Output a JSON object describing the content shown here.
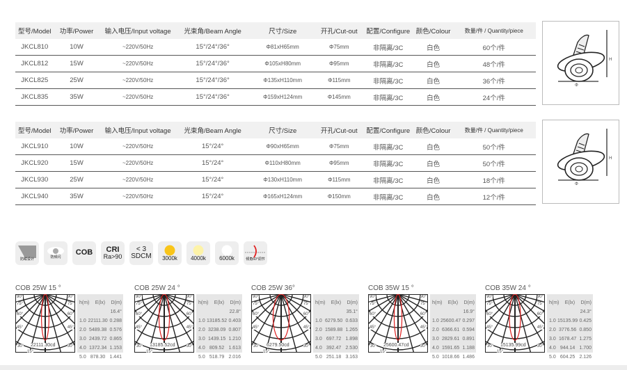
{
  "table_headers": [
    "型号/Model",
    "功率/Power",
    "输入电压/Input voltage",
    "光束角/Beam Angle",
    "尺寸/Size",
    "开孔/Cut-out",
    "配置/Configure",
    "颜色/Colour",
    "数量/件 / Quantity/piece"
  ],
  "table1": [
    [
      "JKCL810",
      "10W",
      "~220V/50Hz",
      "15°/24°/36°",
      "Φ81xH65mm",
      "Φ75mm",
      "非隔离/3C",
      "白色",
      "60个/件"
    ],
    [
      "JKCL812",
      "15W",
      "~220V/50Hz",
      "15°/24°/36°",
      "Φ105xH80mm",
      "Φ95mm",
      "非隔离/3C",
      "白色",
      "48个/件"
    ],
    [
      "JKCL825",
      "25W",
      "~220V/50Hz",
      "15°/24°/36°",
      "Φ135xH110mm",
      "Φ115mm",
      "非隔离/3C",
      "白色",
      "36个/件"
    ],
    [
      "JKCL835",
      "35W",
      "~220V/50Hz",
      "15°/24°/36°",
      "Φ159xH124mm",
      "Φ145mm",
      "非隔离/3C",
      "白色",
      "24个/件"
    ]
  ],
  "table2": [
    [
      "JKCL910",
      "10W",
      "~220V/50Hz",
      "15°/24°",
      "Φ90xH65mm",
      "Φ75mm",
      "非隔离/3C",
      "白色",
      "50个/件"
    ],
    [
      "JKCL920",
      "15W",
      "~220V/50Hz",
      "15°/24°",
      "Φ110xH80mm",
      "Φ95mm",
      "非隔离/3C",
      "白色",
      "50个/件"
    ],
    [
      "JKCL930",
      "25W",
      "~220V/50Hz",
      "15°/24°",
      "Φ130xH110mm",
      "Φ115mm",
      "非隔离/3C",
      "白色",
      "18个/件"
    ],
    [
      "JKCL940",
      "35W",
      "~220V/50Hz",
      "15°/24°",
      "Φ165xH124mm",
      "Φ150mm",
      "非隔离/3C",
      "白色",
      "12个/件"
    ]
  ],
  "product_labels": {
    "height": "H",
    "diameter": "Φ"
  },
  "features": [
    {
      "icon": "anti-glare-icon",
      "label": "防眩设计"
    },
    {
      "icon": "eye-icon",
      "label": "防频闪"
    },
    {
      "icon": "cob-icon",
      "label": "COB"
    },
    {
      "icon": "cri-icon",
      "label": "CRI",
      "sub": "Ra>90"
    },
    {
      "icon": "sdcm-icon",
      "label": "< 3",
      "sub": "SDCM"
    },
    {
      "icon": "color-temp-icon",
      "label": "3000k",
      "color": "#f9c51a"
    },
    {
      "icon": "color-temp-icon",
      "label": "4000k",
      "color": "#fdf3a8"
    },
    {
      "icon": "color-temp-icon",
      "label": "6000k",
      "color": "#ffffff"
    },
    {
      "icon": "tilt-adjust-icon",
      "label": "倾角60°调节"
    }
  ],
  "photometric_headers": [
    "h(m)",
    "E(lx)",
    "D(m)"
  ],
  "angle_labels": [
    "90°",
    "75°",
    "60°",
    "45°",
    "30°",
    "15°"
  ],
  "photometrics": [
    {
      "title": "COB 25W  15 °",
      "cd": "22111.30cd",
      "angle": "16.4°",
      "rows": [
        [
          "1.0",
          "22111.30",
          "0.288"
        ],
        [
          "2.0",
          "5489.38",
          "0.576"
        ],
        [
          "3.0",
          "2439.72",
          "0.865"
        ],
        [
          "4.0",
          "1372.34",
          "1.153"
        ],
        [
          "5.0",
          "878.30",
          "1.441"
        ]
      ]
    },
    {
      "title": "COB 25W  24 °",
      "cd": "13185.52cd",
      "angle": "22.8°",
      "rows": [
        [
          "1.0",
          "13185.52",
          "0.403"
        ],
        [
          "2.0",
          "3238.09",
          "0.807"
        ],
        [
          "3.0",
          "1439.15",
          "1.210"
        ],
        [
          "4.0",
          "809.52",
          "1.613"
        ],
        [
          "5.0",
          "518.79",
          "2.016"
        ]
      ]
    },
    {
      "title": "COB 25W  36°",
      "cd": "6279.50cd",
      "angle": "35.1°",
      "rows": [
        [
          "1.0",
          "6279.50",
          "0.633"
        ],
        [
          "2.0",
          "1589.88",
          "1.265"
        ],
        [
          "3.0",
          "697.72",
          "1.898"
        ],
        [
          "4.0",
          "392.47",
          "2.530"
        ],
        [
          "5.0",
          "251.18",
          "3.163"
        ]
      ]
    },
    {
      "title": "COB 35W  15 °",
      "cd": "25600.47cd",
      "angle": "16.9°",
      "rows": [
        [
          "1.0",
          "25600.47",
          "0.297"
        ],
        [
          "2.0",
          "6366.61",
          "0.594"
        ],
        [
          "3.0",
          "2829.61",
          "0.891"
        ],
        [
          "4.0",
          "1591.65",
          "1.188"
        ],
        [
          "5.0",
          "1018.66",
          "1.486"
        ]
      ]
    },
    {
      "title": "COB 35W  24 °",
      "cd": "15135.99cd",
      "angle": "24.3°",
      "rows": [
        [
          "1.0",
          "15135.99",
          "0.425"
        ],
        [
          "2.0",
          "3776.56",
          "0.850"
        ],
        [
          "3.0",
          "1678.47",
          "1.275"
        ],
        [
          "4.0",
          "944.14",
          "1.700"
        ],
        [
          "5.0",
          "604.25",
          "2.126"
        ]
      ]
    }
  ],
  "colors": {
    "beam": "#e02020",
    "header_bg": "#f1f1f1"
  }
}
